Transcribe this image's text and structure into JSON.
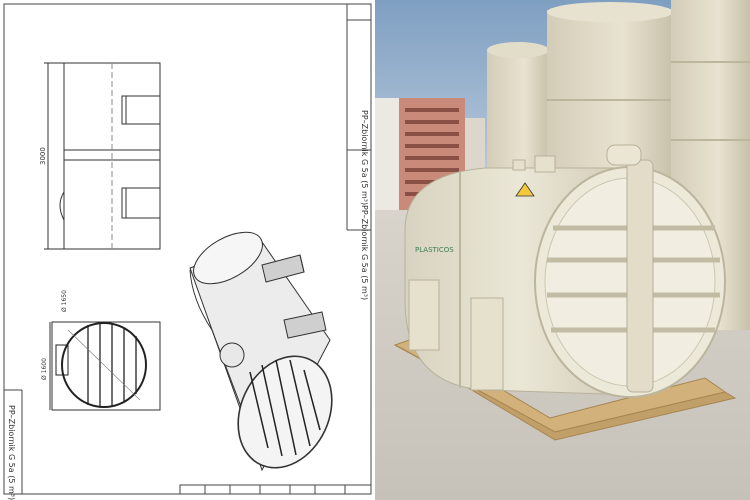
{
  "drawing": {
    "title_block_text": "PP–Zbiornik G 5a (5 m³)",
    "side_label": "PP–Zbiornik G 5a (5 m³)",
    "dimensions": {
      "height": "3000",
      "diameter_top": "Ø 1650",
      "diameter_side": "Ø 1600"
    },
    "table_cells": [
      "",
      "",
      "",
      "",
      "",
      "",
      ""
    ]
  },
  "photo": {
    "logo_text": "PLASTICOS",
    "warning_symbol": "⚠"
  }
}
